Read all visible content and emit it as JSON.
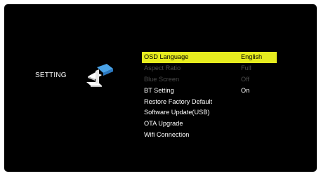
{
  "page": {
    "title": "SETTING"
  },
  "icons": {
    "settings": "settings-tiles-icon"
  },
  "menu": {
    "selected_index": 0,
    "items": [
      {
        "label": "OSD Language",
        "value": "English",
        "state": "selected"
      },
      {
        "label": "Aspect Ratio",
        "value": "Full",
        "state": "disabled"
      },
      {
        "label": "Blue Screen",
        "value": "Off",
        "state": "disabled"
      },
      {
        "label": "BT Setting",
        "value": "On",
        "state": "normal"
      },
      {
        "label": "Restore Factory Default",
        "value": "",
        "state": "normal"
      },
      {
        "label": "Software Update(USB)",
        "value": "",
        "state": "normal"
      },
      {
        "label": "OTA Upgrade",
        "value": "",
        "state": "normal"
      },
      {
        "label": "Wifi Connection",
        "value": "",
        "state": "normal"
      }
    ]
  },
  "colors": {
    "background": "#000000",
    "highlight": "#e6ec1f",
    "text": "#ffffff",
    "disabled_text": "#4c4c4c",
    "icon_blue": "#4aa3e8"
  }
}
